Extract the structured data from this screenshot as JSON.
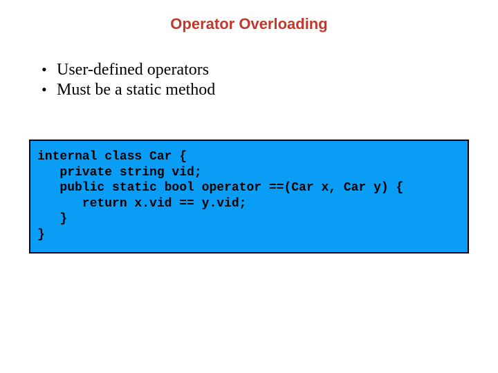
{
  "title": "Operator Overloading",
  "bullets": [
    "User-defined operators",
    "Must be a static method"
  ],
  "code": {
    "line1": "internal class Car {",
    "line2": "   private string vid;",
    "line3": "   public static bool operator ==(Car x, Car y) {",
    "line4": "      return x.vid == y.vid;",
    "line5": "   }",
    "line6": "}"
  }
}
